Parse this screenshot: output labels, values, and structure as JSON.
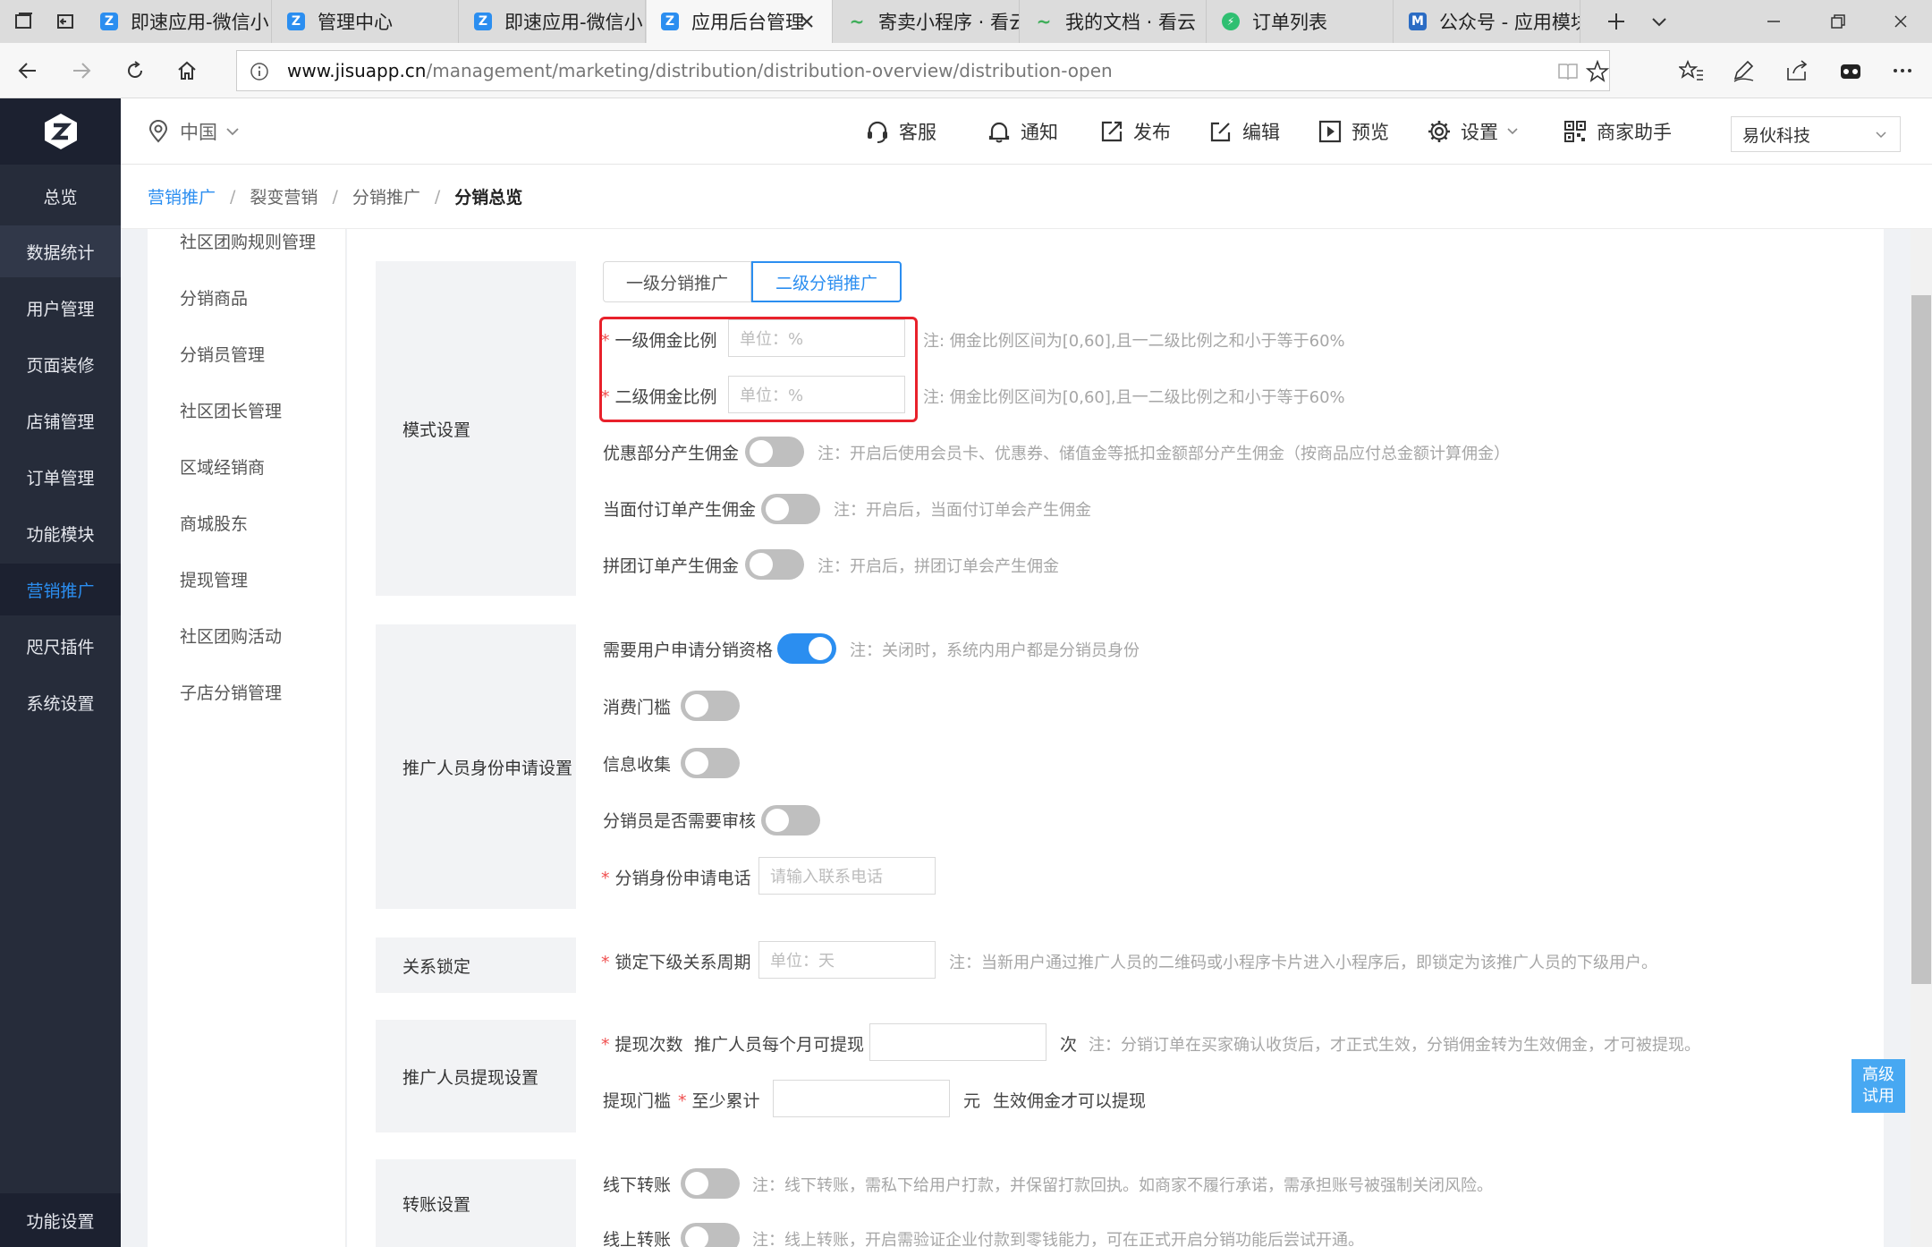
{
  "browser": {
    "tabs": [
      {
        "label": "即速应用-微信小",
        "fav_color": "#2b8ef0",
        "fav_glyph": "Z"
      },
      {
        "label": "管理中心",
        "fav_color": "#2b8ef0",
        "fav_glyph": "Z"
      },
      {
        "label": "即速应用-微信小",
        "fav_color": "#2b8ef0",
        "fav_glyph": "Z"
      },
      {
        "label": "应用后台管理",
        "fav_color": "#2b8ef0",
        "fav_glyph": "Z"
      },
      {
        "label": "寄卖小程序 · 看云",
        "fav_color": "#3fae5a",
        "fav_glyph": "~"
      },
      {
        "label": "我的文档 · 看云",
        "fav_color": "#3fae5a",
        "fav_glyph": "~"
      },
      {
        "label": "订单列表",
        "fav_color": "#2fbf71",
        "fav_glyph": "⚡"
      },
      {
        "label": "公众号 - 应用模块",
        "fav_color": "#2b6cc4",
        "fav_glyph": "M"
      }
    ],
    "url_domain": "www.jisuapp.cn",
    "url_path": "/management/marketing/distribution/distribution-overview/distribution-open"
  },
  "sidebar": {
    "items": [
      {
        "label": "总览"
      },
      {
        "label": "数据统计"
      },
      {
        "label": "用户管理"
      },
      {
        "label": "页面装修"
      },
      {
        "label": "店铺管理"
      },
      {
        "label": "订单管理"
      },
      {
        "label": "功能模块"
      },
      {
        "label": "营销推广"
      },
      {
        "label": "咫尺插件"
      },
      {
        "label": "系统设置"
      }
    ],
    "bottom": "功能设置"
  },
  "header": {
    "region": "中国",
    "items": [
      "客服",
      "通知",
      "发布",
      "编辑",
      "预览",
      "设置",
      "商家助手"
    ],
    "company": "易伙科技"
  },
  "breadcrumb": [
    "营销推广",
    "裂变营销",
    "分销推广",
    "分销总览"
  ],
  "subnav": [
    "社区团购规则管理",
    "分销商品",
    "分销员管理",
    "社区团长管理",
    "区域经销商",
    "商城股东",
    "提现管理",
    "社区团购活动",
    "子店分销管理"
  ],
  "mode": {
    "section": "模式设置",
    "seg_one": "一级分销推广",
    "seg_two": "二级分销推广",
    "first_label": "一级佣金比例",
    "first_placeholder": "单位：%",
    "second_label": "二级佣金比例",
    "second_placeholder": "单位：%",
    "ratio_note": "注: 佣金比例区间为[0,60],且一二级比例之和小于等于60%",
    "discount_label": "优惠部分产生佣金",
    "discount_note": "注：开启后使用会员卡、优惠券、储值金等抵扣金额部分产生佣金（按商品应付总金额计算佣金）",
    "face_label": "当面付订单产生佣金",
    "face_note": "注：开启后，当面付订单会产生佣金",
    "group_label": "拼团订单产生佣金",
    "group_note": "注：开启后，拼团订单会产生佣金"
  },
  "apply": {
    "section": "推广人员身份申请设置",
    "need_label": "需要用户申请分销资格",
    "need_note": "注：关闭时，系统内用户都是分销员身份",
    "need_on": true,
    "threshold_label": "消费门槛",
    "info_label": "信息收集",
    "review_label": "分销员是否需要审核",
    "phone_label": "分销身份申请电话",
    "phone_placeholder": "请输入联系电话"
  },
  "lock": {
    "section": "关系锁定",
    "period_label": "锁定下级关系周期",
    "period_placeholder": "单位：天",
    "note": "注：当新用户通过推广人员的二维码或小程序卡片进入小程序后，即锁定为该推广人员的下级用户。"
  },
  "withdraw": {
    "section": "推广人员提现设置",
    "times_label": "提现次数",
    "times_prefix": "推广人员每个月可提现",
    "times_unit": "次",
    "times_note": "注：分销订单在买家确认收货后，才正式生效，分销佣金转为生效佣金，才可被提现。",
    "threshold_label": "提现门槛",
    "threshold_prefix": "至少累计",
    "threshold_unit": "元",
    "threshold_suffix": "生效佣金才可以提现"
  },
  "transfer": {
    "section": "转账设置",
    "offline_label": "线下转账",
    "offline_note": "注：线下转账，需私下给用户打款，并保留打款回执。如商家不履行承诺，需承担账号被强制关闭风险。",
    "online_label": "线上转账",
    "online_note": "注：线上转账，开启需验证企业付款到零钱能力，可在正式开启分销功能后尝试开通。"
  },
  "trial": {
    "line1": "高级",
    "line2": "试用"
  }
}
